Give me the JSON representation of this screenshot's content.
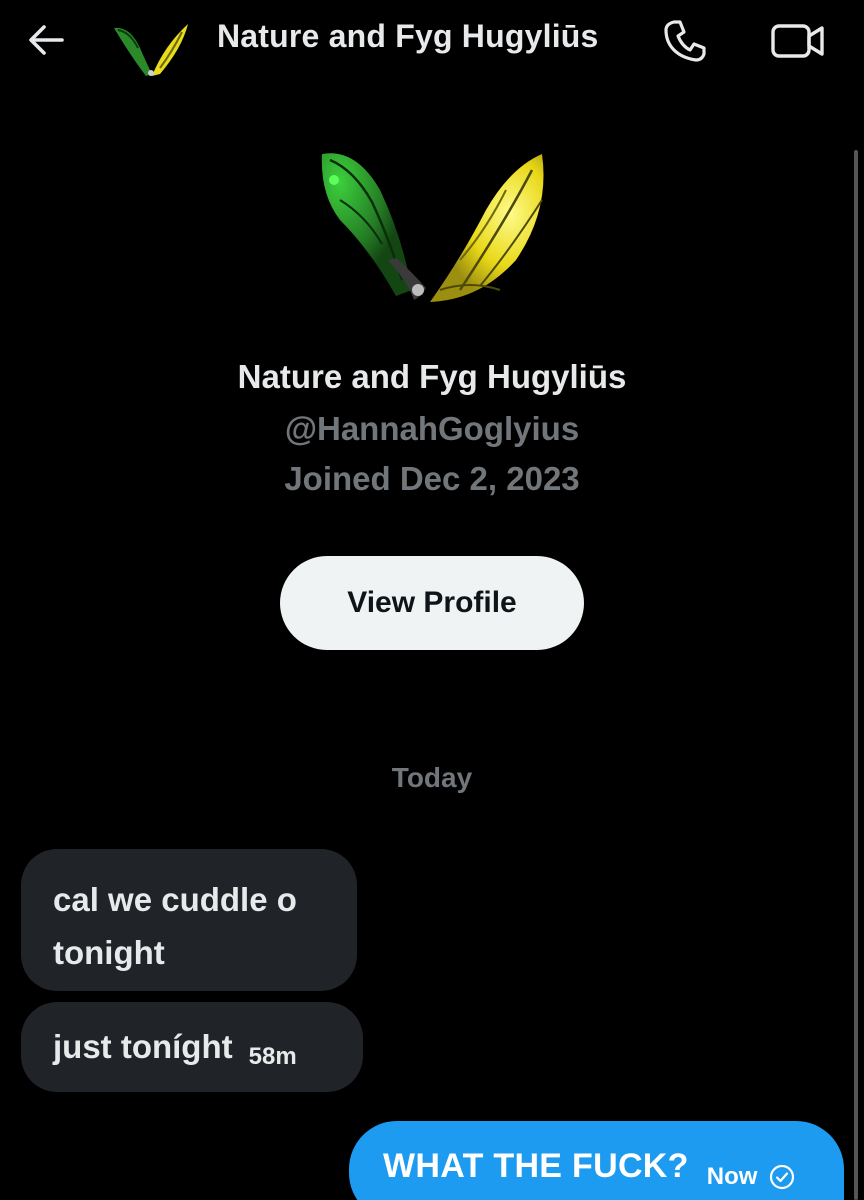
{
  "header": {
    "title": "Nature and Fyg Hugyliūs",
    "back_icon": "back-arrow-icon",
    "call_icon": "phone-icon",
    "video_icon": "video-camera-icon"
  },
  "profile": {
    "name": "Nature and Fyg Hugyliūs",
    "handle": "@HannahGoglyius",
    "joined": "Joined Dec 2, 2023",
    "view_profile_label": "View Profile"
  },
  "conversation": {
    "date_separator": "Today",
    "messages": [
      {
        "direction": "incoming",
        "text_line1": "cal we cuddle o",
        "text_line2": "tonight",
        "time": ""
      },
      {
        "direction": "incoming",
        "text": "just toníght",
        "time": "58m"
      },
      {
        "direction": "outgoing",
        "text": "WHAT THE FUCK?",
        "time": "Now",
        "status_icon": "check-circle-icon"
      }
    ]
  },
  "colors": {
    "background": "#000000",
    "primary_text": "#e7e9ea",
    "secondary_text": "#71767b",
    "incoming_bubble": "#202327",
    "outgoing_bubble": "#1d9bf0",
    "button_bg": "#eff3f4",
    "avatar_green": "#2e8b2e",
    "avatar_yellow": "#f2e21a"
  }
}
